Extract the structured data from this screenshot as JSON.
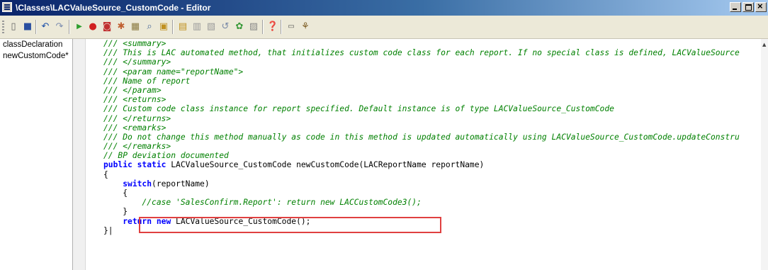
{
  "window": {
    "title": "\\Classes\\LACValueSource_CustomCode - Editor"
  },
  "toolbar_icons": [
    "new-icon",
    "save-icon",
    "undo-icon",
    "redo-icon",
    "run-icon",
    "breakpoint-icon",
    "remove-breakpoints-icon",
    "enable-breakpoint-icon",
    "lookup-icon",
    "find-icon",
    "properties-icon",
    "script-icon",
    "scripts-icon",
    "scripts-alt-icon",
    "compile-icon",
    "best-practices-icon",
    "source-control-icon",
    "help-icon",
    "labels-icon",
    "vertical-display-icon"
  ],
  "methods": [
    "classDeclaration",
    "newCustomCode*"
  ],
  "code": [
    [
      {
        "t": "/// <summary>",
        "s": "c"
      }
    ],
    [
      {
        "t": "/// This is LAC automated method, that initializes custom code class for each report. If no special class is defined, LACValueSource",
        "s": "c"
      }
    ],
    [
      {
        "t": "/// </summary>",
        "s": "c"
      }
    ],
    [
      {
        "t": "/// <param name=\"reportName\">",
        "s": "c"
      }
    ],
    [
      {
        "t": "/// Name of report",
        "s": "c"
      }
    ],
    [
      {
        "t": "/// </param>",
        "s": "c"
      }
    ],
    [
      {
        "t": "/// <returns>",
        "s": "c"
      }
    ],
    [
      {
        "t": "/// Custom code class instance for report specified. Default instance is of type LACValueSource_CustomCode",
        "s": "c"
      }
    ],
    [
      {
        "t": "/// </returns>",
        "s": "c"
      }
    ],
    [
      {
        "t": "/// <remarks>",
        "s": "c"
      }
    ],
    [
      {
        "t": "/// Do not change this method manually as code in this method is updated automatically using LACValueSource_CustomCode.updateConstru",
        "s": "c"
      }
    ],
    [
      {
        "t": "/// </remarks>",
        "s": "c"
      }
    ],
    [
      {
        "t": "// BP deviation documented",
        "s": "c"
      }
    ],
    [
      {
        "t": "public",
        "s": "k"
      },
      {
        "t": " ",
        "s": ""
      },
      {
        "t": "static",
        "s": "k"
      },
      {
        "t": " LACValueSource_CustomCode newCustomCode(LACReportName reportName)",
        "s": ""
      }
    ],
    [
      {
        "t": "{",
        "s": ""
      }
    ],
    [
      {
        "t": "    ",
        "s": ""
      },
      {
        "t": "switch",
        "s": "k"
      },
      {
        "t": "(reportName)",
        "s": ""
      }
    ],
    [
      {
        "t": "    {",
        "s": ""
      }
    ],
    [
      {
        "t": "        ",
        "s": ""
      },
      {
        "t": "//case 'SalesConfirm.Report': return new LACCustomCode3();",
        "s": "c"
      }
    ],
    [
      {
        "t": "    }",
        "s": ""
      }
    ],
    [
      {
        "t": "    ",
        "s": ""
      },
      {
        "t": "return",
        "s": "k"
      },
      {
        "t": " ",
        "s": ""
      },
      {
        "t": "new",
        "s": "k"
      },
      {
        "t": " LACValueSource_CustomCode();",
        "s": ""
      }
    ],
    [
      {
        "t": "}|",
        "s": ""
      }
    ]
  ],
  "colors": {
    "comment": "#008000",
    "keyword": "#0000ff",
    "highlight_box": "#e04040",
    "title_bar": "#0a246a"
  }
}
